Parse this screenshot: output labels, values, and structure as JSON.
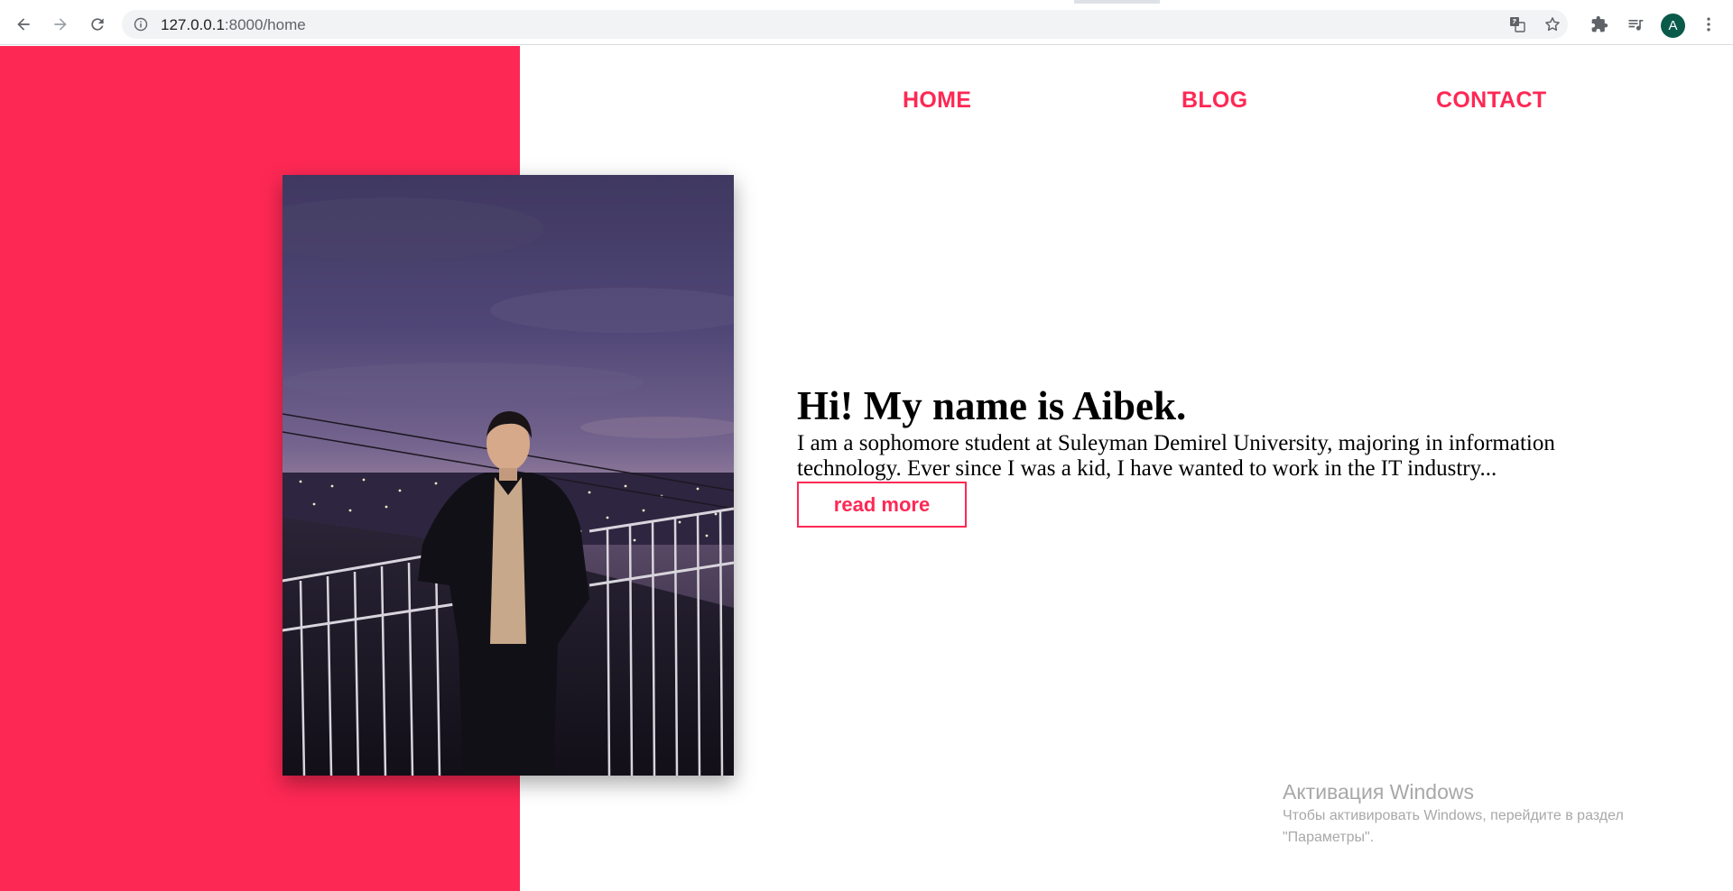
{
  "browser": {
    "url_host": "127.0.0.1",
    "url_rest": ":8000/home",
    "icons": [
      "back-icon",
      "forward-icon",
      "reload-icon",
      "info-icon",
      "translate-icon",
      "star-icon",
      "extensions-icon",
      "media-queue-icon",
      "menu-icon"
    ],
    "profile_initial": "A",
    "profile_color": "#0a5a4a"
  },
  "nav": {
    "home": "HOME",
    "blog": "BLOG",
    "contact": "CONTACT"
  },
  "hero": {
    "title": "Hi! My name is Aibek.",
    "text": "I am a sophomore student at Suleyman Demirel University, majoring in information technology. Ever since I was a kid, I have wanted to work in the IT industry...",
    "button": "read more"
  },
  "watermark": {
    "title": "Активация Windows",
    "line1": "Чтобы активировать Windows, перейдите в раздел",
    "line2": "\"Параметры\"."
  },
  "colors": {
    "accent": "#fe2854",
    "text": "#000000",
    "watermark": "#a8a8a8"
  }
}
